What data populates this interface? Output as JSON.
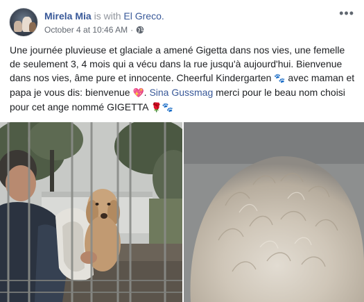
{
  "post": {
    "author": "Mirela Mia",
    "with_text": "is with",
    "tagged_place": "El Greco.",
    "date": "October 4 at 10:46 AM",
    "separator": "·",
    "privacy_icon": "globe-icon",
    "more_label": "•••",
    "text": {
      "part1": "Une journée pluvieuse et glaciale a amené Gigetta dans nos vies, une femelle de seulement 3, 4 mois qui a vécu dans la rue jusqu'à aujourd'hui. Bienvenue dans nos vies, âme pure et innocente. Cheerful Kindergarten ",
      "emoji_paw_1": "🐾",
      "part2": " avec maman et papa je vous dis: bienvenue ",
      "emoji_heart": "💖",
      "part3": ". ",
      "mention": "Sina Gussmag",
      "part4": " merci pour le beau nom choisi pour cet ange nommé GIGETTA ",
      "emoji_rose": "🌹",
      "emoji_paw_2": "🐾"
    },
    "photos": [
      {
        "description": "man holding puppy behind fence",
        "alt": "photo-1"
      },
      {
        "description": "close-up of puppy fur",
        "alt": "photo-2"
      }
    ]
  },
  "colors": {
    "link": "#385898",
    "meta": "#616770",
    "text": "#1c1e21"
  }
}
